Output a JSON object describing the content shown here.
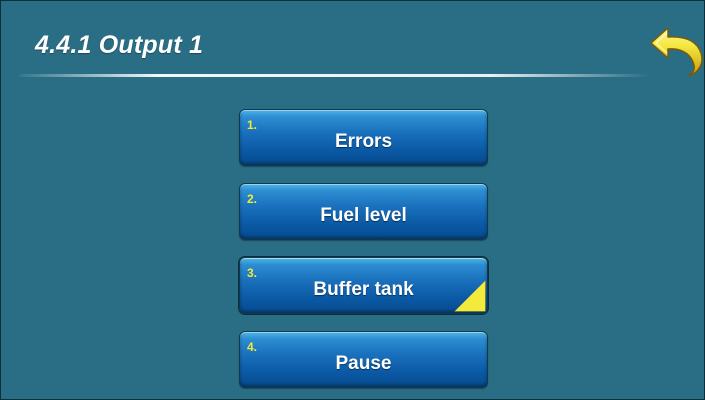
{
  "header": {
    "title": "4.4.1 Output 1"
  },
  "back_button": {
    "icon": "back-arrow-icon",
    "color": "#f2e63a"
  },
  "menu": {
    "items": [
      {
        "number": "1.",
        "label": "Errors",
        "selected": false
      },
      {
        "number": "2.",
        "label": "Fuel level",
        "selected": false
      },
      {
        "number": "3.",
        "label": "Buffer tank",
        "selected": true
      },
      {
        "number": "4.",
        "label": "Pause",
        "selected": false
      }
    ]
  },
  "colors": {
    "background": "#2a6e86",
    "button": "#0a58a3",
    "number": "#f1e93a",
    "selected_marker": "#f3ea3c"
  }
}
